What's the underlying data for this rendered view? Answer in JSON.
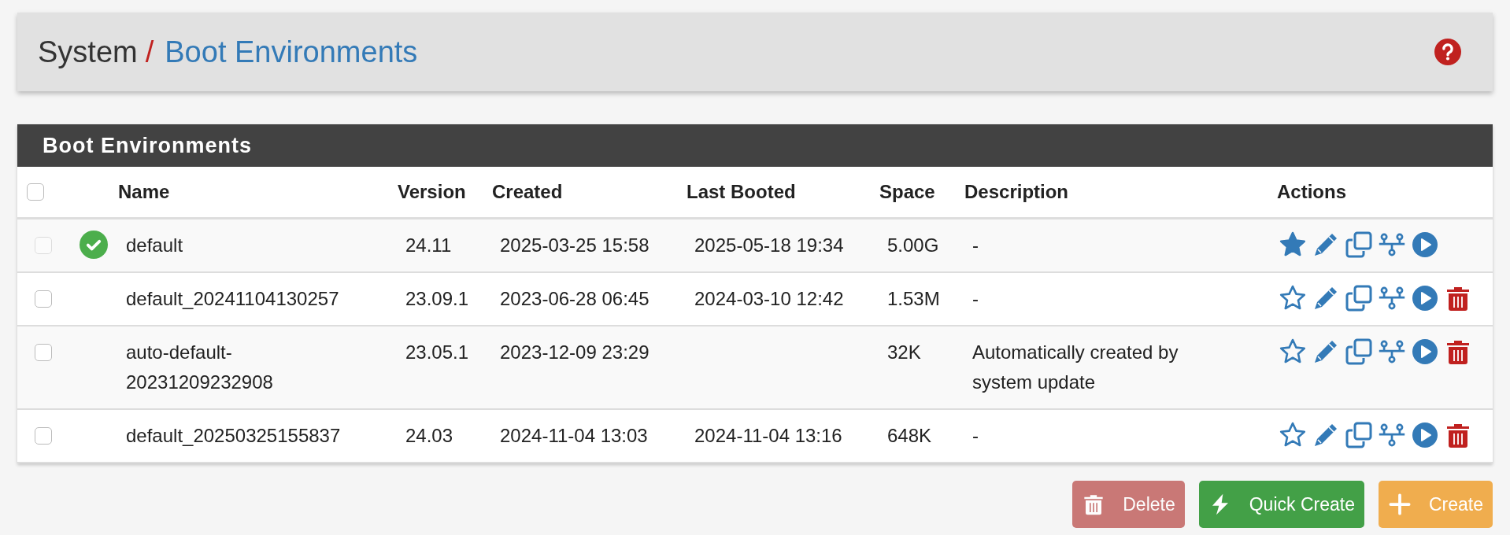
{
  "breadcrumb": {
    "parent": "System",
    "separator": "/",
    "current": "Boot Environments"
  },
  "panel": {
    "title": "Boot Environments"
  },
  "table": {
    "select_all": {
      "checked": false
    },
    "columns": [
      "Name",
      "Version",
      "Created",
      "Last Booted",
      "Space",
      "Description",
      "Actions"
    ],
    "rows": [
      {
        "checked": false,
        "disabled": true,
        "active": true,
        "name": "default",
        "version": "24.11",
        "created": "2025-03-25 15:58",
        "last_booted": "2025-05-18 19:34",
        "space": "5.00G",
        "description": "-",
        "is_default": true,
        "deletable": false
      },
      {
        "checked": false,
        "disabled": false,
        "active": false,
        "name": "default_20241104130257",
        "version": "23.09.1",
        "created": "2023-06-28 06:45",
        "last_booted": "2024-03-10 12:42",
        "space": "1.53M",
        "description": "-",
        "is_default": false,
        "deletable": true
      },
      {
        "checked": false,
        "disabled": false,
        "active": false,
        "name": "auto-default-20231209232908",
        "version": "23.05.1",
        "created": "2023-12-09 23:29",
        "space": "32K",
        "description": "Automatically created by system update",
        "is_default": false,
        "deletable": true
      },
      {
        "checked": false,
        "disabled": false,
        "active": false,
        "name": "default_20250325155837",
        "version": "24.03",
        "created": "2024-11-04 13:03",
        "last_booted": "2024-11-04 13:16",
        "space": "648K",
        "description": "-",
        "is_default": false,
        "deletable": true
      }
    ]
  },
  "buttons": [
    {
      "kind": "delete",
      "label": "Delete",
      "disabled": true
    },
    {
      "kind": "quick",
      "label": "Quick Create",
      "disabled": false
    },
    {
      "kind": "create",
      "label": "Create",
      "disabled": false
    }
  ]
}
